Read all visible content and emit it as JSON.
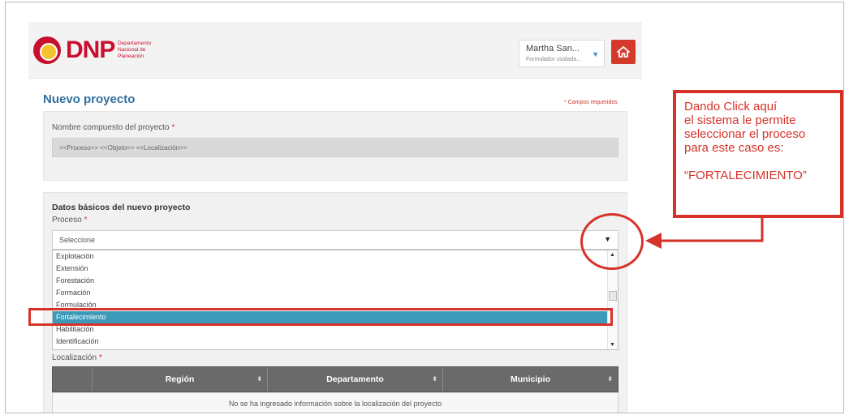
{
  "header": {
    "logo_text": "DNP",
    "logo_sub": "Departamento Nacional de Planeación",
    "user_name": "Martha San...",
    "user_role": "Formulador ciudada...",
    "home_icon": "home-icon"
  },
  "page": {
    "title": "Nuevo proyecto",
    "required_note": "* Campos requeridos"
  },
  "name_section": {
    "label": "Nombre compuesto del proyecto",
    "required_mark": "*",
    "value": "<<Proceso>> <<Objeto>> <<Localización>>"
  },
  "basic_section": {
    "title": "Datos básicos del nuevo proyecto",
    "proceso_label": "Proceso",
    "required_mark": "*",
    "select_value": "Seleccione",
    "options": [
      "Explotación",
      "Extensión",
      "Forestación",
      "Formación",
      "Formulación",
      "Fortalecimiento",
      "Habilitación",
      "Identificación"
    ],
    "selected_option": "Fortalecimiento"
  },
  "location": {
    "label": "Localización",
    "required_mark": "*",
    "columns": [
      "Región",
      "Departamento",
      "Municipio"
    ],
    "empty_message": "No se ha ingresado información sobre la localización del proyecto"
  },
  "annotation": {
    "lines": [
      "Dando Click aquí",
      "el sistema le permite",
      "seleccionar el proceso",
      "para este caso es:"
    ],
    "target": "“FORTALECIMIENTO”",
    "color": "#d6322a"
  }
}
